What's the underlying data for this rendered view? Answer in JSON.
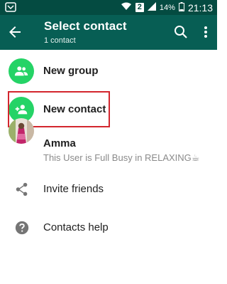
{
  "status_bar": {
    "sim_slot": "2",
    "battery": "14%",
    "time": "21:13",
    "icons": [
      "usb-debug-icon",
      "wifi-icon",
      "signal-icon",
      "battery-icon"
    ]
  },
  "app_bar": {
    "title": "Select contact",
    "subtitle": "1 contact",
    "icons": [
      "back-arrow-icon",
      "search-icon",
      "more-vert-icon"
    ]
  },
  "actions": [
    {
      "label": "New group",
      "icon": "group-icon"
    },
    {
      "label": "New contact",
      "icon": "add-person-icon"
    }
  ],
  "contacts": [
    {
      "name": "Amma",
      "status": "This User is Full Busy in RELAXING☕"
    }
  ],
  "footer_items": [
    {
      "label": "Invite friends",
      "icon": "share-icon"
    },
    {
      "label": "Contacts help",
      "icon": "help-icon"
    }
  ],
  "colors": {
    "status_bar": "#044b41",
    "app_bar": "#075e54",
    "accent": "#25d366",
    "highlight": "#d3262e"
  }
}
